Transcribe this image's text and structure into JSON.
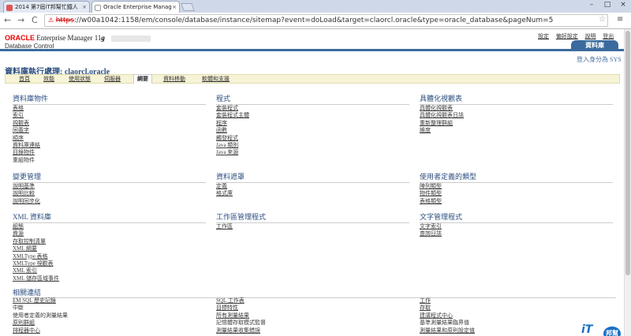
{
  "browser": {
    "tabs": [
      {
        "label": "2014 第7屆iT邦幫忙鐵人",
        "close": "×"
      },
      {
        "label": "Oracle Enterprise Manag",
        "close": "×"
      }
    ],
    "window_controls": [
      "–",
      "□",
      "×"
    ],
    "nav": {
      "back": "←",
      "forward": "→",
      "reload": "C"
    },
    "url_scheme": "https",
    "url_rest": "://w00a1042:1158/em/console/database/instance/sitemap?event=doLoad&target=claorcl.oracle&type=oracle_database&pageNum=5",
    "star": "☆",
    "menu": "≡"
  },
  "header": {
    "oracle": "ORACLE",
    "em": "Enterprise Manager 11",
    "ver": "g",
    "database_control": "Database Control",
    "links": [
      "設定",
      "偏好設定",
      "說明",
      "登出"
    ],
    "db_tab": "資料庫",
    "logged_in": "登入身分為 SYS"
  },
  "title": "資料庫執行處理: claorcl.oracle",
  "subtabs": [
    "首頁",
    "效能",
    "使用狀態",
    "伺服器",
    "綱要",
    "資料移動",
    "軟體和支援"
  ],
  "sections": [
    {
      "heading": "資料庫物件",
      "links": [
        "表格",
        "索引",
        "視觀表",
        "同義字",
        "順序",
        "資料庫連結",
        "目錄物件",
        "重組物件"
      ],
      "plain": [
        7
      ]
    },
    {
      "heading": "程式",
      "links": [
        "套裝程式",
        "套裝程式主體",
        "程序",
        "函數",
        "觸發程式",
        "Java 類別",
        "Java 來源"
      ],
      "plain": []
    },
    {
      "heading": "具體化視觀表",
      "links": [
        "具體化視觀表",
        "具體化視觀表日誌",
        "重新整理群組",
        "維度"
      ],
      "plain": []
    },
    {
      "heading": "變更管理",
      "links": [
        "說明基準",
        "說明比較",
        "說明同步化"
      ],
      "plain": []
    },
    {
      "heading": "資料遮罩",
      "links": [
        "定義",
        "格式庫"
      ],
      "plain": []
    },
    {
      "heading": "使用者定義的類型",
      "links": [
        "陣列類型",
        "物件類型",
        "表格類型"
      ],
      "plain": []
    },
    {
      "heading": "XML 資料庫",
      "links": [
        "組態",
        "資源",
        "存取控制清單",
        "XML 綱要",
        "XMLType 表格",
        "XMLType 視觀表",
        "XML 索引",
        "XML 儲存區域事件"
      ],
      "plain": []
    },
    {
      "heading": "工作區管理程式",
      "links": [
        "工作區"
      ],
      "plain": []
    },
    {
      "heading": "文字管理程式",
      "links": [
        "文字索引",
        "查詢日誌"
      ],
      "plain": []
    }
  ],
  "related": {
    "heading": "相關連結",
    "col1": {
      "links": [
        "EM SQL 歷史記錄",
        "中斷",
        "使用者定義的測量結果",
        "原則群組",
        "排程器中心"
      ],
      "plain": [
        1,
        2
      ]
    },
    "col2": {
      "links": [
        "SQL 工作表",
        "目標特性",
        "所有測量結果",
        "記憶體存取模式監督",
        "測量結果收集錯誤"
      ],
      "plain": [
        3
      ]
    },
    "col3": {
      "links": [
        "工作",
        "存取",
        "建議程式中心",
        "基準測量結果臨界值",
        "測量結果和原則設定值"
      ],
      "plain": [
        3
      ]
    }
  },
  "watermark": {
    "it": "iT",
    "cn": "邦幫忙"
  }
}
